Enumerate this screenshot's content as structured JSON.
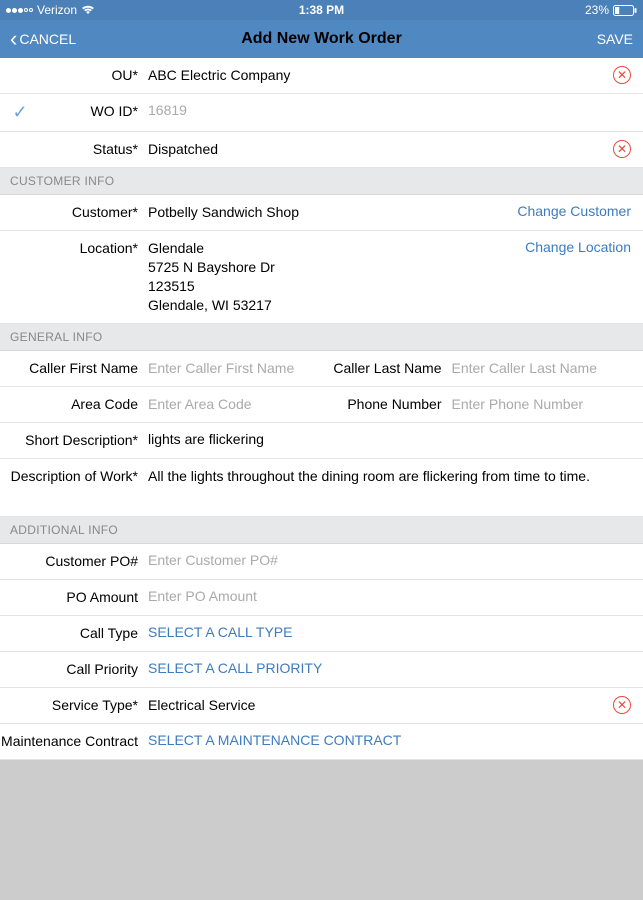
{
  "statusbar": {
    "carrier": "Verizon",
    "time": "1:38 PM",
    "battery": "23%"
  },
  "nav": {
    "cancel": "CANCEL",
    "title": "Add New Work Order",
    "save": "SAVE"
  },
  "header_rows": {
    "ou_label": "OU*",
    "ou_value": "ABC Electric Company",
    "woid_label": "WO ID*",
    "woid_value": "16819",
    "status_label": "Status*",
    "status_value": "Dispatched"
  },
  "sections": {
    "customer": "CUSTOMER INFO",
    "general": "GENERAL INFO",
    "additional": "ADDITIONAL INFO"
  },
  "customer": {
    "label": "Customer*",
    "value": "Potbelly Sandwich Shop",
    "change": "Change Customer",
    "location_label": "Location*",
    "location_line1": "Glendale",
    "location_line2": "5725 N Bayshore Dr",
    "location_line3": "123515",
    "location_line4": "Glendale, WI 53217",
    "change_location": "Change Location"
  },
  "general": {
    "caller_first_label": "Caller First Name",
    "caller_first_ph": "Enter Caller First Name",
    "caller_last_label": "Caller Last Name",
    "caller_last_ph": "Enter Caller Last Name",
    "area_code_label": "Area Code",
    "area_code_ph": "Enter Area Code",
    "phone_label": "Phone Number",
    "phone_ph": "Enter Phone Number",
    "short_desc_label": "Short Description*",
    "short_desc_value": "lights are flickering",
    "desc_work_label": "Description of Work*",
    "desc_work_value": "All the lights throughout the dining room are flickering from time to time."
  },
  "additional": {
    "cust_po_label": "Customer PO#",
    "cust_po_ph": "Enter Customer PO#",
    "po_amount_label": "PO Amount",
    "po_amount_ph": "Enter PO Amount",
    "call_type_label": "Call Type",
    "call_type_value": "SELECT A CALL TYPE",
    "call_priority_label": "Call Priority",
    "call_priority_value": "SELECT A CALL PRIORITY",
    "service_type_label": "Service Type*",
    "service_type_value": "Electrical Service",
    "maint_contract_label": "Maintenance Contract",
    "maint_contract_value": "SELECT A MAINTENANCE CONTRACT"
  }
}
